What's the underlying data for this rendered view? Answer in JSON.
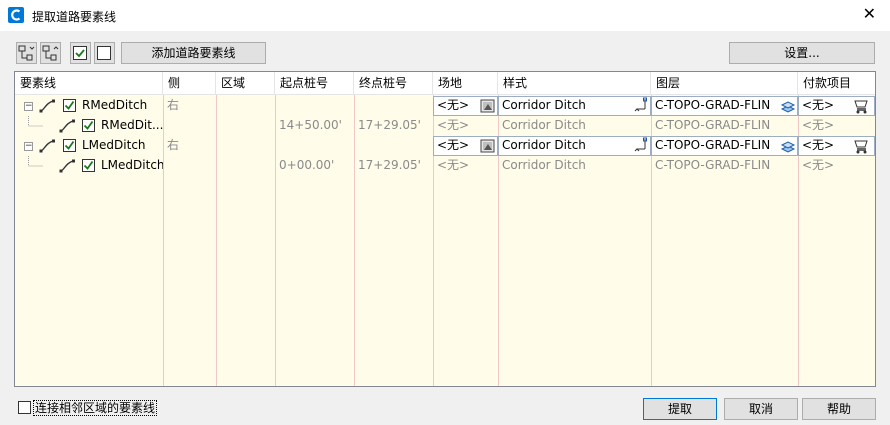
{
  "window": {
    "title": "提取道路要素线",
    "close_glyph": "✕"
  },
  "toolbar": {
    "add_button": "添加道路要素线",
    "settings_button": "设置..."
  },
  "table": {
    "columns": [
      "要素线",
      "侧",
      "区域",
      "起点桩号",
      "终点桩号",
      "场地",
      "样式",
      "图层",
      "付款项目"
    ],
    "rows": [
      {
        "name": "RMedDitch",
        "side": "右",
        "region": "",
        "start": "",
        "end": "",
        "site": "<无>",
        "style": "Corridor Ditch",
        "layer": "C-TOPO-GRAD-FLIN",
        "pay": "<无>",
        "checked": true
      },
      {
        "name": "RMedDit...",
        "side": "",
        "region": "",
        "start": "14+50.00'",
        "end": "17+29.05'",
        "site": "<无>",
        "style": "Corridor Ditch",
        "layer": "C-TOPO-GRAD-FLIN",
        "pay": "<无>",
        "checked": true
      },
      {
        "name": "LMedDitch",
        "side": "右",
        "region": "",
        "start": "",
        "end": "",
        "site": "<无>",
        "style": "Corridor Ditch",
        "layer": "C-TOPO-GRAD-FLIN",
        "pay": "<无>",
        "checked": true
      },
      {
        "name": "LMedDitch",
        "side": "",
        "region": "",
        "start": "0+00.00'",
        "end": "17+29.05'",
        "site": "<无>",
        "style": "Corridor Ditch",
        "layer": "C-TOPO-GRAD-FLIN",
        "pay": "<无>",
        "checked": true
      }
    ]
  },
  "footer": {
    "connect_label": "连接相邻区域的要素线",
    "extract_button": "提取",
    "cancel_button": "取消",
    "help_button": "帮助"
  },
  "colors": {
    "grid_bg": "#fffde9",
    "column_line": "#f0c8c8",
    "accent": "#0078d7"
  }
}
